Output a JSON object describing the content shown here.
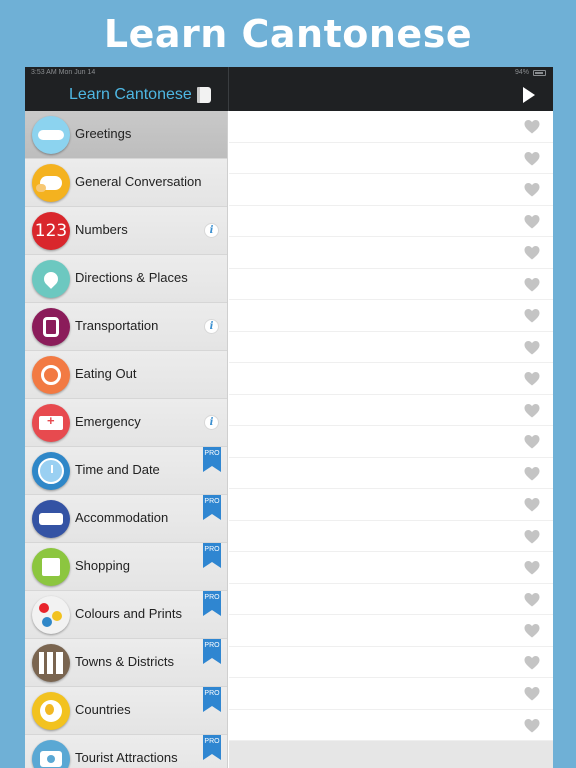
{
  "banner": {
    "title": "Learn Cantonese"
  },
  "status_bar": {
    "time": "3:53 AM  Mon Jun 14",
    "battery": "94%"
  },
  "nav": {
    "title": "Learn Cantonese"
  },
  "colors": {
    "banner_bg": "#6fb0d6",
    "nav_bg": "#1f2123",
    "nav_title": "#4eb7e3",
    "pro_badge": "#2f86d1",
    "heart": "#c4c4c4"
  },
  "categories": [
    {
      "label": "Greetings",
      "icon": "handshake-icon",
      "color": "#8cd3ef",
      "selected": true,
      "info": false,
      "pro": false
    },
    {
      "label": "General Conversation",
      "icon": "speech-bubbles-icon",
      "color": "#f4b21f",
      "selected": false,
      "info": false,
      "pro": false
    },
    {
      "label": "Numbers",
      "icon": "numbers-123-icon",
      "color": "#d9262c",
      "selected": false,
      "info": true,
      "pro": false
    },
    {
      "label": "Directions & Places",
      "icon": "map-pin-icon",
      "color": "#6cc8c0",
      "selected": false,
      "info": false,
      "pro": false
    },
    {
      "label": "Transportation",
      "icon": "tram-icon",
      "color": "#8b1c5a",
      "selected": false,
      "info": true,
      "pro": false
    },
    {
      "label": "Eating Out",
      "icon": "plate-cutlery-icon",
      "color": "#f27a43",
      "selected": false,
      "info": false,
      "pro": false
    },
    {
      "label": "Emergency",
      "icon": "ambulance-icon",
      "color": "#e74a4f",
      "selected": false,
      "info": true,
      "pro": false
    },
    {
      "label": "Time and Date",
      "icon": "clock-icon",
      "color": "#2f87c8",
      "selected": false,
      "info": false,
      "pro": true
    },
    {
      "label": "Accommodation",
      "icon": "bed-icon",
      "color": "#3453a4",
      "selected": false,
      "info": false,
      "pro": true
    },
    {
      "label": "Shopping",
      "icon": "shopping-bag-icon",
      "color": "#8cc63f",
      "selected": false,
      "info": false,
      "pro": true
    },
    {
      "label": "Colours and Prints",
      "icon": "colour-dots-icon",
      "color": "#f2f2f2",
      "selected": false,
      "info": false,
      "pro": true
    },
    {
      "label": "Towns & Districts",
      "icon": "city-skyline-icon",
      "color": "#7a6550",
      "selected": false,
      "info": false,
      "pro": true
    },
    {
      "label": "Countries",
      "icon": "globe-icon",
      "color": "#f2c21f",
      "selected": false,
      "info": false,
      "pro": true
    },
    {
      "label": "Tourist Attractions",
      "icon": "camera-icon",
      "color": "#5aa8d4",
      "selected": false,
      "info": false,
      "pro": true
    }
  ],
  "badges": {
    "pro": "PRO",
    "info": "i"
  },
  "phrase_rows": 20
}
